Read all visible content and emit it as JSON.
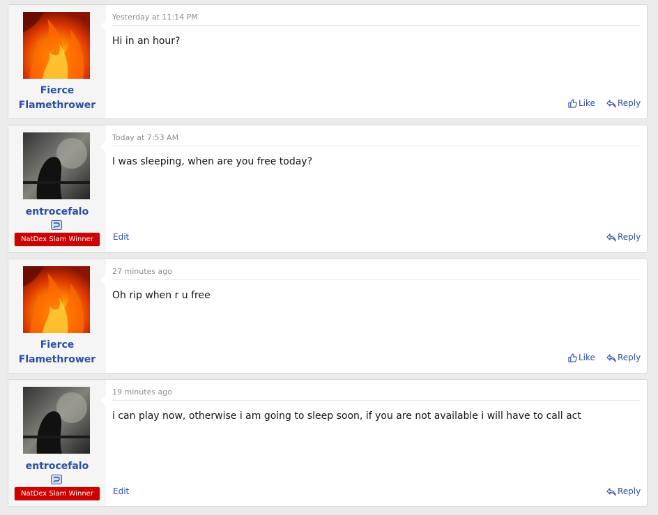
{
  "posts": [
    {
      "username_line1": "Fierce",
      "username_line2": "Flamethrower",
      "avatar": "flame-avatar",
      "timestamp": "Yesterday at 11:14 PM",
      "message": "Hi in an hour?",
      "like_label": "Like",
      "reply_label": "Reply"
    },
    {
      "username_line1": "entrocefalo",
      "avatar": "dark-figure-avatar",
      "banner": "NatDex Slam Winner",
      "banner_icon": "trophy-badge-icon",
      "timestamp": "Today at 7:53 AM",
      "message": "I was sleeping, when are you free today?",
      "edit_label": "Edit",
      "reply_label": "Reply"
    },
    {
      "username_line1": "Fierce",
      "username_line2": "Flamethrower",
      "avatar": "flame-avatar",
      "timestamp": "27 minutes ago",
      "message": "Oh rip when r u free",
      "like_label": "Like",
      "reply_label": "Reply"
    },
    {
      "username_line1": "entrocefalo",
      "avatar": "dark-figure-avatar",
      "banner": "NatDex Slam Winner",
      "banner_icon": "trophy-badge-icon",
      "timestamp": "19 minutes ago",
      "message": "i can play now, otherwise i am going to sleep soon, if you are not available i will have to call act",
      "edit_label": "Edit",
      "reply_label": "Reply"
    }
  ],
  "colors": {
    "link": "#2b4f9f",
    "banner_bg": "#cc0000",
    "user_cell_bg": "#f5f5f5",
    "page_bg": "#ebebeb"
  }
}
